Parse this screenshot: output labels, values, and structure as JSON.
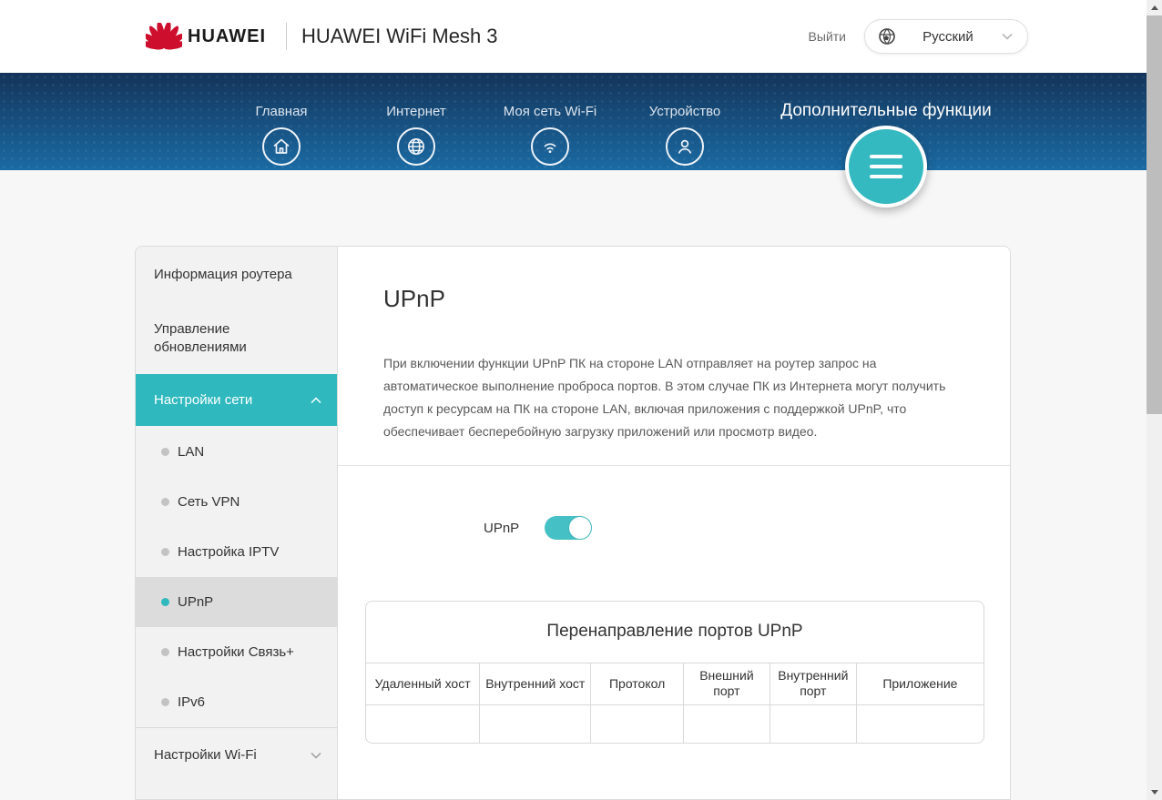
{
  "header": {
    "brand": "HUAWEI",
    "product": "HUAWEI WiFi Mesh 3",
    "logout_label": "Выйти",
    "language": "Русский"
  },
  "nav": {
    "items": [
      {
        "label": "Главная",
        "icon": "home-icon"
      },
      {
        "label": "Интернет",
        "icon": "internet-globe-icon"
      },
      {
        "label": "Моя сеть Wi-Fi",
        "icon": "wifi-icon"
      },
      {
        "label": "Устройство",
        "icon": "device-user-icon"
      }
    ],
    "advanced_label": "Дополнительные функции",
    "advanced_menu_icon": "hamburger-icon",
    "advanced_active": true
  },
  "sidebar": {
    "items": [
      {
        "label": "Информация роутера"
      },
      {
        "label": "Управление обновлениями"
      },
      {
        "label": "Настройки сети",
        "state": "expanded",
        "active": true
      }
    ],
    "network_subitems": [
      {
        "label": "LAN"
      },
      {
        "label": "Сеть VPN"
      },
      {
        "label": "Настройка IPTV"
      },
      {
        "label": "UPnP",
        "selected": true
      },
      {
        "label": "Настройки Связь+"
      },
      {
        "label": "IPv6"
      }
    ],
    "wifi_item": {
      "label": "Настройки Wi-Fi",
      "state": "collapsed"
    }
  },
  "main": {
    "title": "UPnP",
    "description": "При включении функции UPnP ПК на стороне LAN отправляет на роутер запрос на автоматическое выполнение проброса портов. В этом случае ПК из Интернета могут получить доступ к ресурсам на ПК на стороне LAN, включая приложения с поддержкой UPnP, что обеспечивает бесперебойную загрузку приложений или просмотр видео.",
    "toggle_label": "UPnP",
    "toggle_state": "on",
    "table": {
      "title": "Перенаправление портов UPnP",
      "headers": [
        "Удаленный хост",
        "Внутренний хост",
        "Протокол",
        "Внешний порт",
        "Внутренний порт",
        "Приложение"
      ],
      "rows": [
        [
          "",
          "",
          "",
          "",
          "",
          ""
        ]
      ]
    }
  },
  "colors": {
    "accent_teal": "#35b9c0",
    "nav_gradient_top": "#14345a",
    "nav_gradient_bottom": "#1a6aa3",
    "brand_red": "#ce0e2d",
    "selected_row_gray": "#dcdcdc"
  }
}
